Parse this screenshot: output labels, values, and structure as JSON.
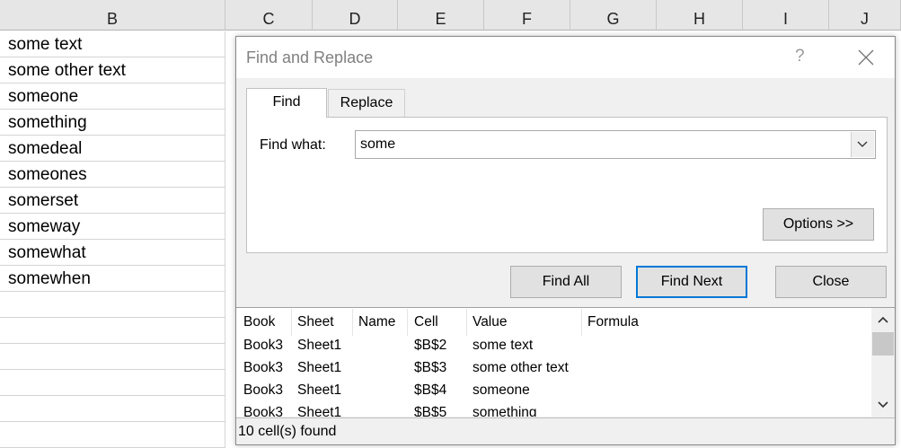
{
  "sheet": {
    "columns": [
      "B",
      "C",
      "D",
      "E",
      "F",
      "G",
      "H",
      "I",
      "J"
    ],
    "cells": [
      "some text",
      "some other text",
      "someone",
      "something",
      "somedeal",
      "someones",
      "somerset",
      "someway",
      "somewhat",
      "somewhen"
    ]
  },
  "dialog": {
    "title": "Find and Replace",
    "help": "?",
    "tabs": {
      "find": "Find",
      "replace": "Replace"
    },
    "find_label": "Find what:",
    "find_value": "some",
    "buttons": {
      "options": "Options >>",
      "find_all": "Find All",
      "find_next": "Find Next",
      "close": "Close"
    },
    "results": {
      "headers": [
        "Book",
        "Sheet",
        "Name",
        "Cell",
        "Value",
        "Formula"
      ],
      "rows": [
        [
          "Book3",
          "Sheet1",
          "",
          "$B$2",
          "some text",
          ""
        ],
        [
          "Book3",
          "Sheet1",
          "",
          "$B$3",
          "some other text",
          ""
        ],
        [
          "Book3",
          "Sheet1",
          "",
          "$B$4",
          "someone",
          ""
        ],
        [
          "Book3",
          "Sheet1",
          "",
          "$B$5",
          "something",
          ""
        ]
      ]
    },
    "status": "10 cell(s) found"
  }
}
